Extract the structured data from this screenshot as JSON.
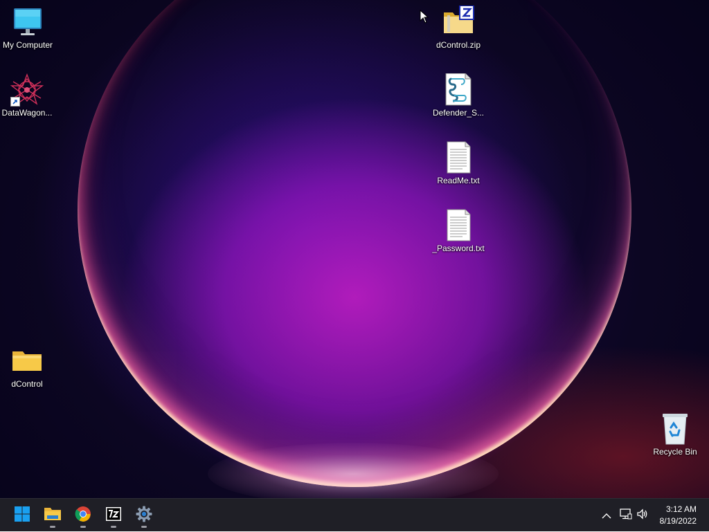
{
  "desktop_icons": {
    "my_computer": "My Computer",
    "datawagon": "DataWagon...",
    "dcontrol_folder": "dControl",
    "dcontrol_zip": "dControl.zip",
    "defender_script": "Defender_S...",
    "readme": "ReadMe.txt",
    "password": "_Password.txt",
    "recycle_bin": "Recycle Bin"
  },
  "taskbar": {
    "apps": [
      {
        "icon": "windows-start-icon"
      },
      {
        "icon": "file-explorer-icon",
        "running": true
      },
      {
        "icon": "chrome-icon",
        "running": true
      },
      {
        "icon": "7zip-icon",
        "running": true
      },
      {
        "icon": "settings-gear-icon",
        "running": true
      }
    ],
    "tray_icons": [
      "chevron-up-icon",
      "network-icon",
      "volume-icon"
    ],
    "time": "3:12 AM",
    "date": "8/19/2022"
  },
  "colors": {
    "taskbar_bg": "#1f1f26",
    "start_blue": "#1aa0f0",
    "folder_yellow": "#f7c948"
  }
}
